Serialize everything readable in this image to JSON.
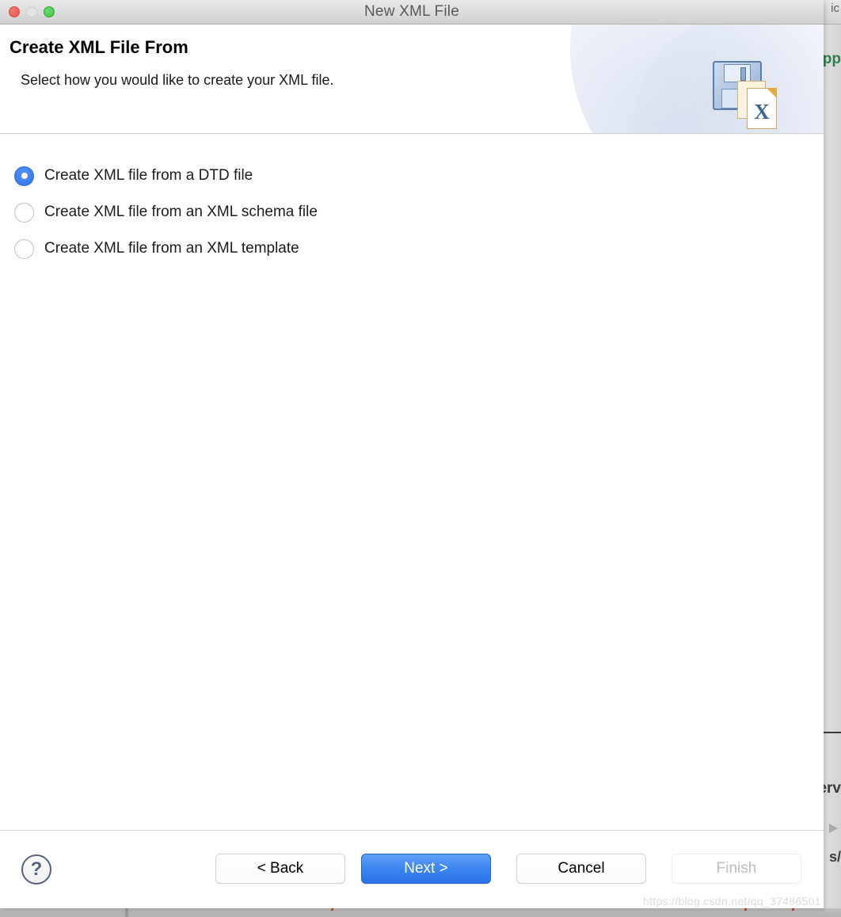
{
  "window": {
    "title": "New XML File",
    "traffic_lights": [
      "close",
      "minimize",
      "maximize"
    ]
  },
  "header": {
    "title": "Create XML File From",
    "subtitle": "Select how you would like to create your XML file.",
    "icon": "xml-file-floppy-icon",
    "icon_letter": "X"
  },
  "options": {
    "selected_index": 0,
    "items": [
      {
        "label": "Create XML file from a DTD file",
        "selected": true
      },
      {
        "label": "Create XML file from an XML schema file",
        "selected": false
      },
      {
        "label": "Create XML file from an XML template",
        "selected": false
      }
    ]
  },
  "footer": {
    "help_label": "?",
    "buttons": [
      {
        "label": "< Back",
        "state": "normal"
      },
      {
        "label": "Next >",
        "state": "primary"
      },
      {
        "label": "Cancel",
        "state": "normal"
      },
      {
        "label": "Finish",
        "state": "disabled"
      }
    ]
  },
  "watermark": {
    "text": "https://blog.csdn.net/qq_37486501"
  },
  "background": {
    "fragments": {
      "top_right": "ic",
      "green_text": "pp",
      "lower_text": "erv",
      "bottom_text": "s/"
    }
  },
  "colors": {
    "accent_blue": "#3d86f0",
    "radio_selected": "#2f74e8",
    "title_text": "#5a5a5a",
    "disabled_text": "#bdbdbd",
    "green_text": "#2e7d4f"
  }
}
